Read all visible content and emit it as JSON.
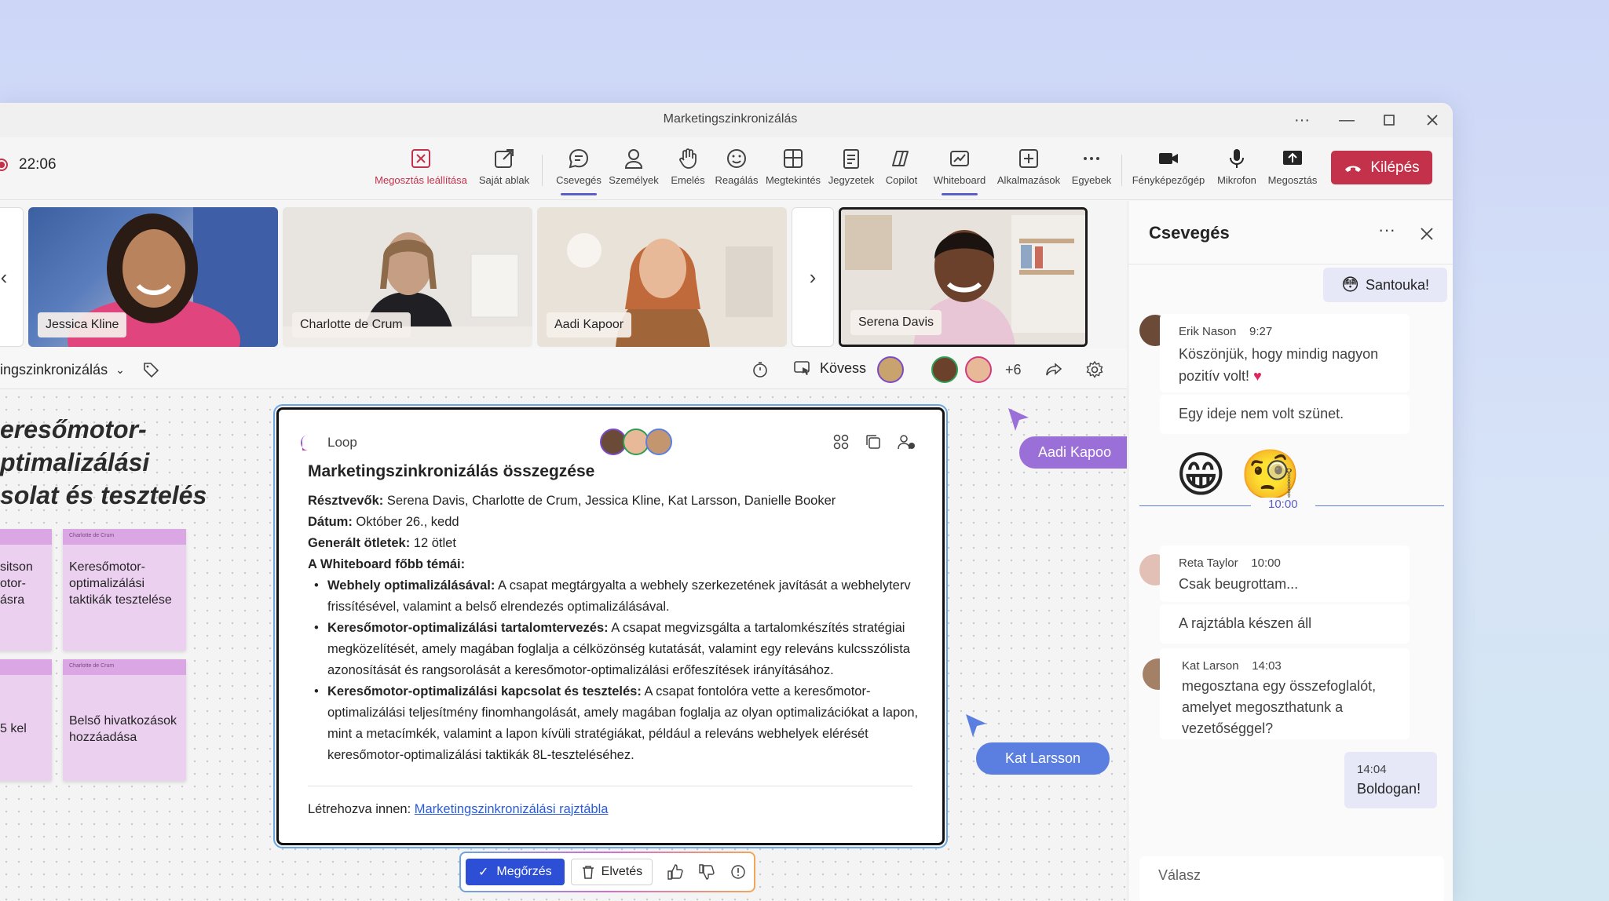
{
  "window": {
    "title": "Marketingszinkronizálás"
  },
  "meeting": {
    "timer": "22:06"
  },
  "toolbar": {
    "items": [
      {
        "label": "Megosztás leállítása"
      },
      {
        "label": "Saját ablak"
      },
      {
        "label": "Csevegés"
      },
      {
        "label": "Személyek"
      },
      {
        "label": "Emelés"
      },
      {
        "label": "Reagálás"
      },
      {
        "label": "Megtekintés"
      },
      {
        "label": "Jegyzetek"
      },
      {
        "label": "Copilot"
      },
      {
        "label": "Whiteboard"
      },
      {
        "label": "Alkalmazások"
      },
      {
        "label": "Egyebek"
      },
      {
        "label": "Fényképezőgép"
      },
      {
        "label": "Mikrofon"
      },
      {
        "label": "Megosztás"
      }
    ],
    "leave_label": "Kilépés"
  },
  "participants": [
    {
      "name": "Jessica Kline"
    },
    {
      "name": "Charlotte de Crum"
    },
    {
      "name": "Aadi Kapoor"
    },
    {
      "name": "Serena Davis"
    }
  ],
  "whiteboard": {
    "title": "ingszinkronizálás",
    "follow_label": "Kövess",
    "more_count": "+6",
    "heading_lines": [
      "eresőmotor-",
      "ptimalizálási",
      "solat és tesztelés"
    ],
    "notes": [
      {
        "author": "",
        "text": "sitson otor- ásra"
      },
      {
        "author": "Charlotte de Crum",
        "text": "Keresőmotor-optimalizálási taktikák tesztelése"
      },
      {
        "author": "",
        "text": "5 kel"
      },
      {
        "author": "Charlotte de Crum",
        "text": "Belső hivatkozások hozzáadása"
      }
    ],
    "cursors": [
      {
        "name": "Aadi Kapoo",
        "color": "#9b6fd8"
      },
      {
        "name": "Kat Larsson",
        "color": "#5b7fe0"
      }
    ]
  },
  "loop": {
    "brand": "Loop",
    "title": "Marketingszinkronizálás összegzése",
    "participants_label": "Résztvevők:",
    "participants_value": " Serena Davis, Charlotte de Crum, Jessica Kline, Kat Larsson, Danielle Booker",
    "date_label": "Dátum:",
    "date_value": " Október 26., kedd",
    "ideas_label": "Generált ötletek:",
    "ideas_value": " 12 ötlet",
    "topics_label": "A Whiteboard főbb témái:",
    "bullets": [
      {
        "bold": "Webhely optimalizálásával:",
        "text": " A csapat megtárgyalta a webhely szerkezetének javítását a webhelyterv frissítésével, valamint a belső elrendezés optimalizálásával."
      },
      {
        "bold": "Keresőmotor-optimalizálási tartalomtervezés:",
        "text": " A csapat megvizsgálta a tartalomkészítés stratégiai megközelítését, amely magában foglalja a célközönség kutatását, valamint egy releváns kulcsszólista azonosítását és rangsorolását a keresőmotor-optimalizálási erőfeszítések irányításához."
      },
      {
        "bold": "Keresőmotor-optimalizálási kapcsolat és tesztelés:",
        "text": " A csapat fontolóra vette a keresőmotor-optimalizálási teljesítmény finomhangolását, amely magában foglalja az olyan optimalizációkat a lapon, mint a metacímkék, valamint a lapon kívüli stratégiákat, például a releváns webhelyek elérését keresőmotor-optimalizálási taktikák 8L-teszteléséhez."
      }
    ],
    "created_label": "Létrehozva innen: ",
    "created_link": "Marketingszinkronizálási rajztábla"
  },
  "loop_actions": {
    "keep": "Megőrzés",
    "discard": "Elvetés"
  },
  "chat": {
    "title": "Csevegés",
    "messages": [
      {
        "sender": "",
        "time": "",
        "text": "Santouka!"
      },
      {
        "sender": "Erik Nason",
        "time": "9:27",
        "text": "Köszönjük, hogy mindig nagyon pozitív volt!",
        "text2": "Egy ideje nem volt szünet."
      },
      {
        "sender": "Reta Taylor",
        "time": "10:00",
        "text": "Csak beugrottam...",
        "text2": "A rajztábla készen áll"
      },
      {
        "sender": "Kat Larson",
        "time": "14:03",
        "text": "megosztana egy összefoglalót, amelyet megoszthatunk a vezetőséggel?"
      },
      {
        "sender": "",
        "time": "14:04",
        "text": "Boldogan!"
      }
    ],
    "divider_time": "10:00",
    "reply_placeholder": "Válasz"
  }
}
